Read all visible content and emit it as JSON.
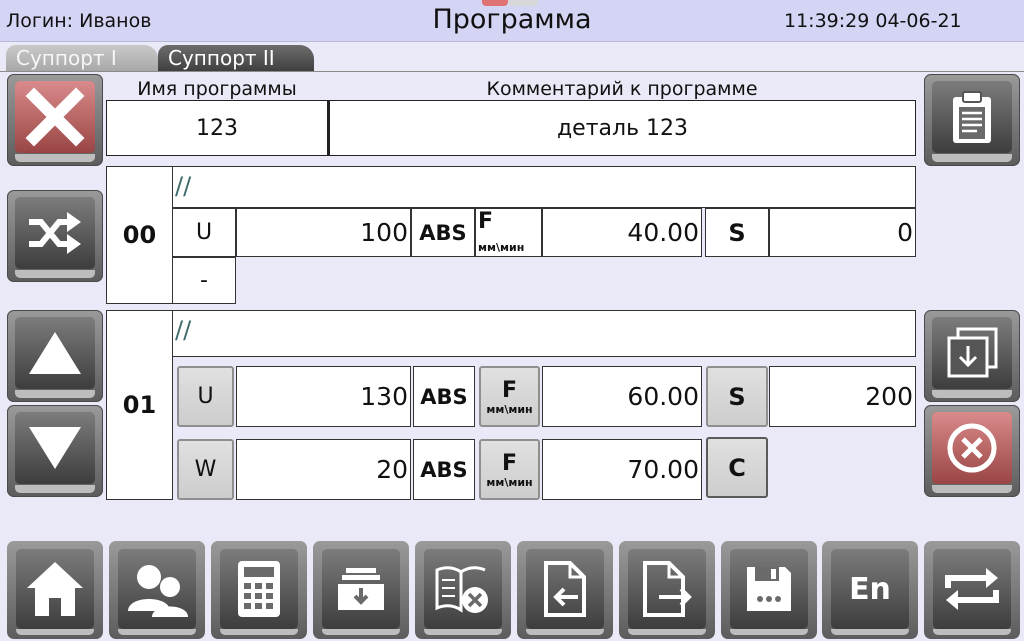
{
  "header": {
    "login": "Логин: Иванов",
    "title": "Программа",
    "clock": "11:39:29 04-06-21"
  },
  "tabs": [
    {
      "label": "Суппорт I",
      "active": false
    },
    {
      "label": "Суппорт II",
      "active": true
    }
  ],
  "program": {
    "name_label": "Имя программы",
    "comment_label": "Комментарий к программе",
    "name_value": "123",
    "comment_value": "деталь 123"
  },
  "rows": [
    {
      "number": "00",
      "comment": "//",
      "axis": "U",
      "value": "100",
      "mode": "ABS",
      "feed_label": "F",
      "feed_unit": "мм\\мин",
      "feed_value": "40.00",
      "s_label": "S",
      "s_value": "0",
      "extra": "-"
    },
    {
      "number": "01",
      "comment": "//",
      "lines": [
        {
          "axis": "U",
          "value": "130",
          "mode": "ABS",
          "feed_label": "F",
          "feed_unit": "мм\\мин",
          "feed_value": "60.00",
          "s_label": "S",
          "s_value": "200"
        },
        {
          "axis": "W",
          "value": "20",
          "mode": "ABS",
          "feed_label": "F",
          "feed_unit": "мм\\мин",
          "feed_value": "70.00",
          "c_label": "C"
        }
      ]
    }
  ],
  "toolbar": {
    "language": "En"
  },
  "colors": {
    "background": "#e9e9f7",
    "header": "#d4d4f4",
    "danger": "#c46060"
  },
  "icons": {
    "left": [
      "close-icon",
      "shuffle-icon",
      "arrow-up-icon",
      "arrow-down-icon"
    ],
    "right": [
      "clipboard-icon",
      "import-icon",
      "cancel-circle-icon"
    ],
    "bottom": [
      "home-icon",
      "users-icon",
      "calculator-icon",
      "archive-icon",
      "delete-book-icon",
      "file-import-icon",
      "file-export-icon",
      "save-icon",
      "language-icon",
      "repeat-icon"
    ]
  }
}
